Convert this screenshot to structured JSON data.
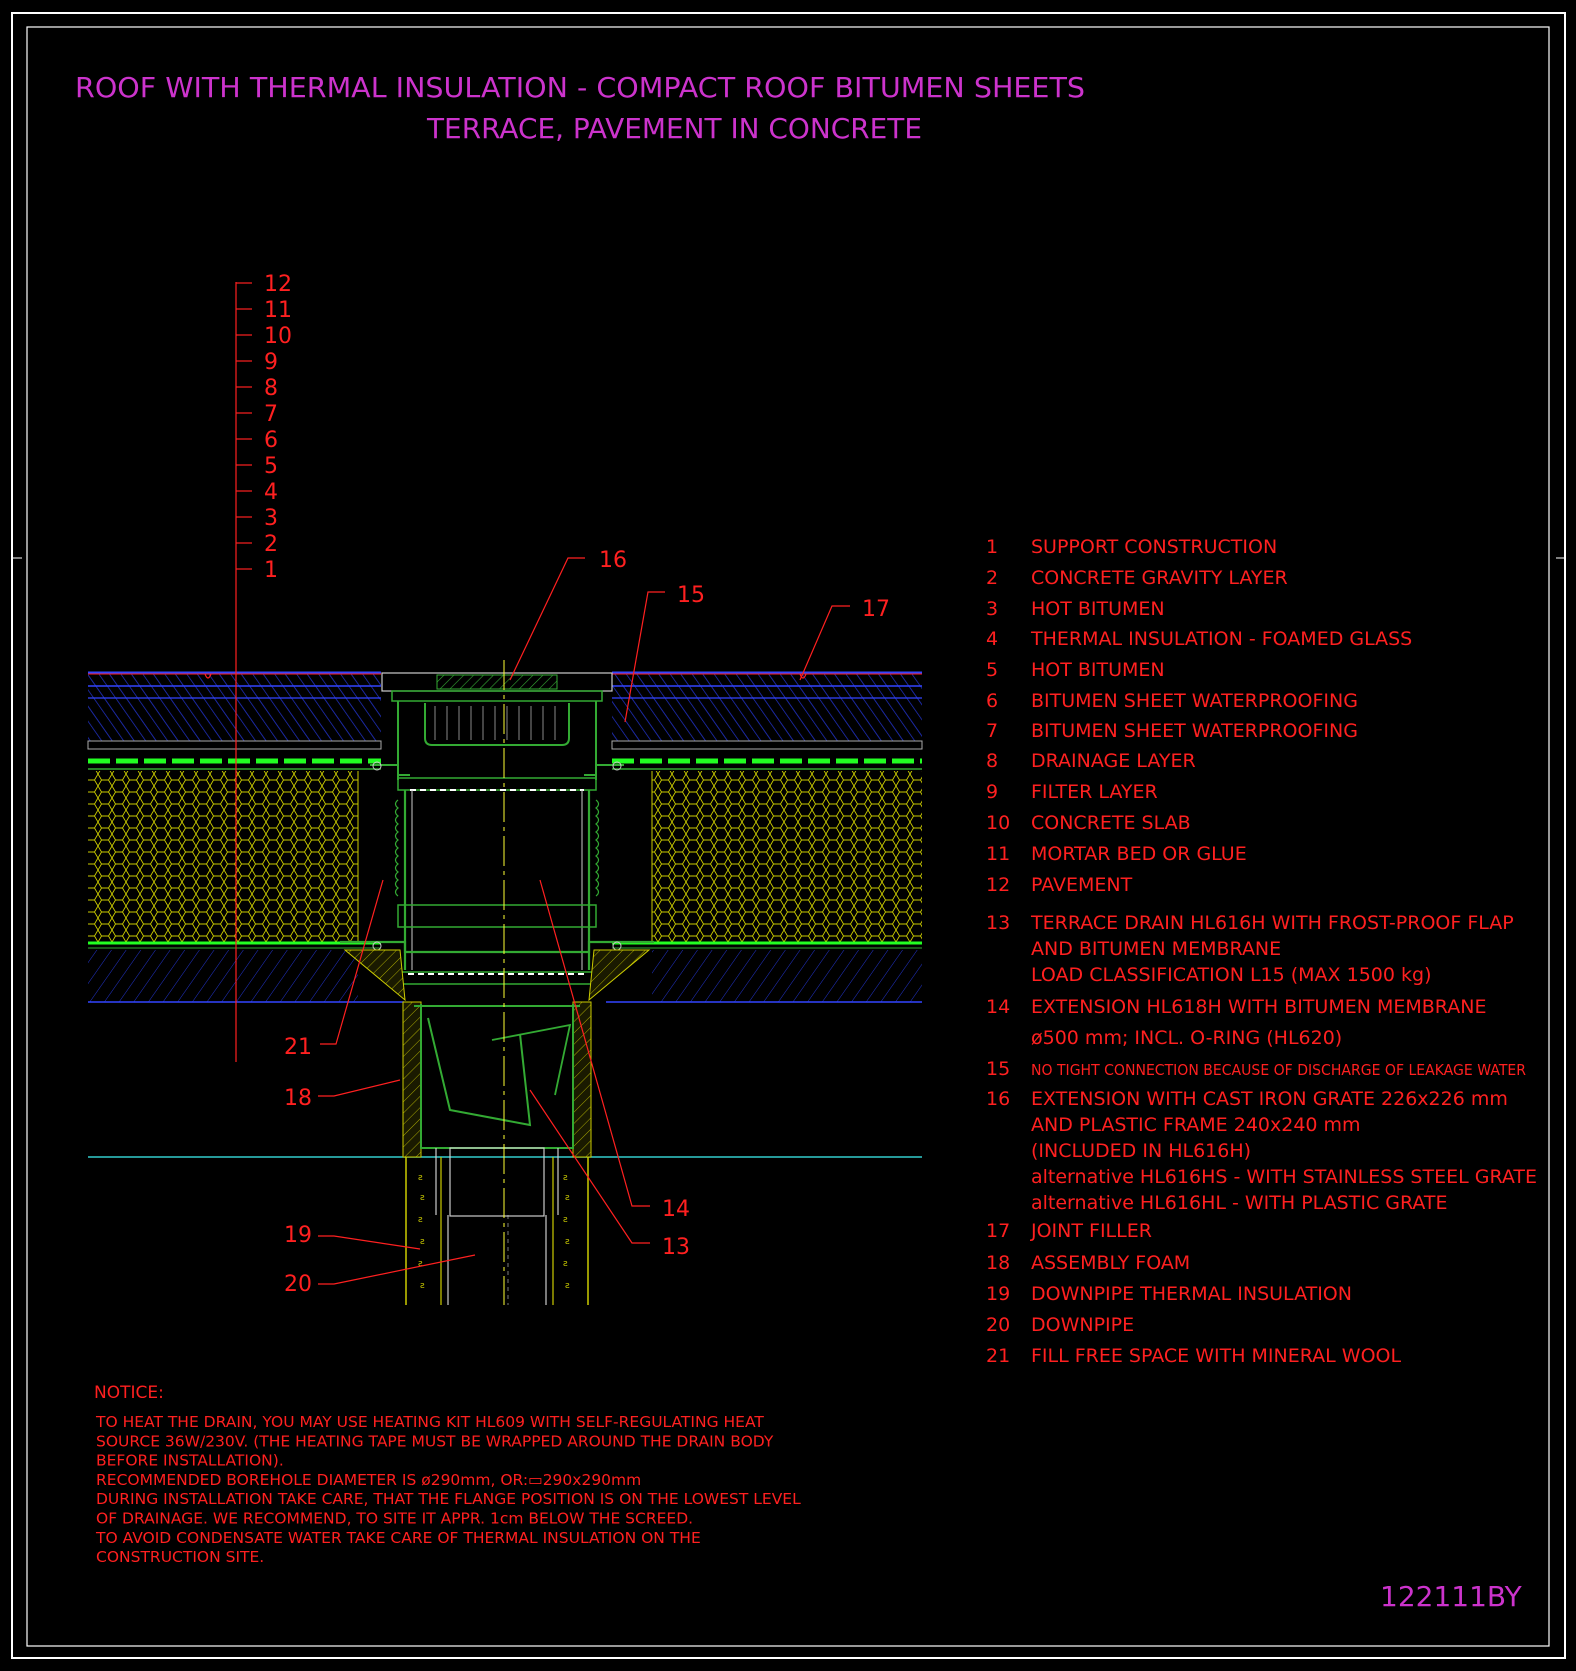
{
  "colors": {
    "background": "#000000",
    "frame": "#ffffff",
    "title": "#cc33cc",
    "label": "#ff2020",
    "concrete_hatch": "#2233cc",
    "insulation": "#cccc00",
    "membrane": "#22ff22",
    "drain": "#33aa33",
    "axis": "#ffff33",
    "ground": "#33cccc"
  },
  "title": {
    "line1": "ROOF WITH THERMAL INSULATION - COMPACT ROOF BITUMEN SHEETS",
    "line2": "TERRACE, PAVEMENT IN CONCRETE"
  },
  "layer_scale": [
    "12",
    "11",
    "10",
    "9",
    "8",
    "7",
    "6",
    "5",
    "4",
    "3",
    "2",
    "1"
  ],
  "callouts": [
    {
      "id": "16",
      "text": "16"
    },
    {
      "id": "15",
      "text": "15"
    },
    {
      "id": "17",
      "text": "17"
    },
    {
      "id": "21",
      "text": "21"
    },
    {
      "id": "18",
      "text": "18"
    },
    {
      "id": "19",
      "text": "19"
    },
    {
      "id": "20",
      "text": "20"
    },
    {
      "id": "14",
      "text": "14"
    },
    {
      "id": "13",
      "text": "13"
    }
  ],
  "legend": [
    {
      "num": "1",
      "lines": [
        "SUPPORT CONSTRUCTION"
      ]
    },
    {
      "num": "2",
      "lines": [
        "CONCRETE GRAVITY LAYER"
      ]
    },
    {
      "num": "3",
      "lines": [
        "HOT BITUMEN"
      ]
    },
    {
      "num": "4",
      "lines": [
        "THERMAL INSULATION - FOAMED GLASS"
      ]
    },
    {
      "num": "5",
      "lines": [
        "HOT BITUMEN"
      ]
    },
    {
      "num": "6",
      "lines": [
        "BITUMEN SHEET WATERPROOFING"
      ]
    },
    {
      "num": "7",
      "lines": [
        "BITUMEN SHEET WATERPROOFING"
      ]
    },
    {
      "num": "8",
      "lines": [
        "DRAINAGE LAYER"
      ]
    },
    {
      "num": "9",
      "lines": [
        "FILTER LAYER"
      ]
    },
    {
      "num": "10",
      "lines": [
        "CONCRETE SLAB"
      ]
    },
    {
      "num": "11",
      "lines": [
        "MORTAR BED OR GLUE"
      ]
    },
    {
      "num": "12",
      "lines": [
        "PAVEMENT"
      ]
    },
    {
      "num": "13",
      "lines": [
        "TERRACE DRAIN HL616H WITH FROST-PROOF FLAP",
        "AND BITUMEN MEMBRANE",
        "LOAD CLASSIFICATION L15 (MAX 1500 kg)"
      ]
    },
    {
      "num": "14",
      "lines": [
        "EXTENSION HL618H WITH BITUMEN MEMBRANE",
        "ø500 mm; INCL. O-RING (HL620)"
      ]
    },
    {
      "num": "15",
      "lines": [
        "NO TIGHT CONNECTION BECAUSE OF DISCHARGE OF LEAKAGE WATER"
      ],
      "small": true
    },
    {
      "num": "16",
      "lines": [
        "EXTENSION WITH CAST IRON GRATE 226x226 mm",
        "AND PLASTIC FRAME 240x240 mm",
        "(INCLUDED IN HL616H)",
        "alternative HL616HS - WITH STAINLESS STEEL GRATE",
        "alternative HL616HL - WITH PLASTIC GRATE"
      ]
    },
    {
      "num": "17",
      "lines": [
        "JOINT FILLER"
      ]
    },
    {
      "num": "18",
      "lines": [
        "ASSEMBLY FOAM"
      ]
    },
    {
      "num": "19",
      "lines": [
        "DOWNPIPE THERMAL INSULATION"
      ]
    },
    {
      "num": "20",
      "lines": [
        "DOWNPIPE"
      ]
    },
    {
      "num": "21",
      "lines": [
        "FILL FREE SPACE WITH MINERAL WOOL"
      ]
    }
  ],
  "notice": {
    "heading": "NOTICE:",
    "lines": [
      "TO HEAT THE DRAIN, YOU MAY USE HEATING KIT HL609 WITH SELF-REGULATING HEAT",
      "SOURCE 36W/230V. (THE HEATING TAPE MUST BE WRAPPED AROUND THE DRAIN BODY",
      "BEFORE INSTALLATION).",
      "RECOMMENDED BOREHOLE DIAMETER IS ø290mm, OR:▭290x290mm",
      "DURING INSTALLATION TAKE CARE, THAT THE FLANGE POSITION IS ON THE LOWEST LEVEL",
      "OF DRAINAGE. WE RECOMMEND, TO SITE IT APPR. 1cm BELOW THE SCREED.",
      "TO AVOID CONDENSATE WATER TAKE CARE OF THERMAL INSULATION ON THE",
      "CONSTRUCTION SITE."
    ]
  },
  "drawing_code": "122111BY"
}
